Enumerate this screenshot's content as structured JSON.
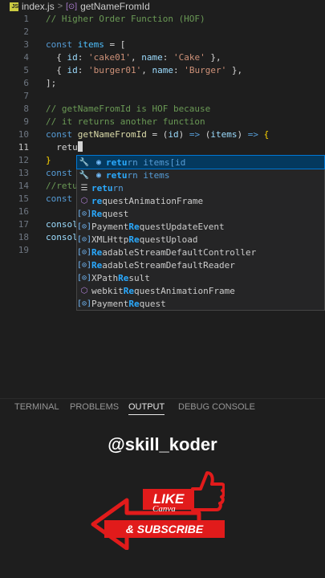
{
  "breadcrumb": {
    "js_badge": "JS",
    "file": "index.js",
    "separator": ">",
    "symbol_icon": "[⊙]",
    "symbol": "getNameFromId"
  },
  "editor": {
    "lines": [
      {
        "n": "1",
        "tokens": [
          [
            "c",
            "// Higher Order Function (HOF)"
          ]
        ]
      },
      {
        "n": "2",
        "tokens": []
      },
      {
        "n": "3",
        "tokens": [
          [
            "k",
            "const "
          ],
          [
            "v",
            "items"
          ],
          [
            "w",
            " = ["
          ]
        ]
      },
      {
        "n": "4",
        "tokens": [
          [
            "w",
            "  { "
          ],
          [
            "p",
            "id"
          ],
          [
            "w",
            ": "
          ],
          [
            "s",
            "'cake01'"
          ],
          [
            "w",
            ", "
          ],
          [
            "p",
            "name"
          ],
          [
            "w",
            ": "
          ],
          [
            "s",
            "'Cake'"
          ],
          [
            "w",
            " },"
          ]
        ]
      },
      {
        "n": "5",
        "tokens": [
          [
            "w",
            "  { "
          ],
          [
            "p",
            "id"
          ],
          [
            "w",
            ": "
          ],
          [
            "s",
            "'burger01'"
          ],
          [
            "w",
            ", "
          ],
          [
            "p",
            "name"
          ],
          [
            "w",
            ": "
          ],
          [
            "s",
            "'Burger'"
          ],
          [
            "w",
            " },"
          ]
        ]
      },
      {
        "n": "6",
        "tokens": [
          [
            "w",
            "];"
          ]
        ]
      },
      {
        "n": "7",
        "tokens": []
      },
      {
        "n": "8",
        "tokens": [
          [
            "c",
            "// getNameFromId is HOF because"
          ]
        ]
      },
      {
        "n": "9",
        "tokens": [
          [
            "c",
            "// it returns another function"
          ]
        ]
      },
      {
        "n": "10",
        "tokens": [
          [
            "k",
            "const "
          ],
          [
            "f",
            "getNameFromId"
          ],
          [
            "w",
            " = ("
          ],
          [
            "p",
            "id"
          ],
          [
            "w",
            ") "
          ],
          [
            "k",
            "=>"
          ],
          [
            "w",
            " ("
          ],
          [
            "p",
            "items"
          ],
          [
            "w",
            ") "
          ],
          [
            "k",
            "=>"
          ],
          [
            "w",
            " "
          ],
          [
            "y",
            "{"
          ]
        ]
      },
      {
        "n": "11",
        "tokens": [
          [
            "w",
            "  retu"
          ]
        ],
        "cursor": true
      },
      {
        "n": "12",
        "tokens": [
          [
            "y",
            "}"
          ]
        ]
      },
      {
        "n": "13",
        "tokens": [
          [
            "k",
            "const "
          ]
        ]
      },
      {
        "n": "14",
        "tokens": [
          [
            "c",
            "//retu"
          ]
        ]
      },
      {
        "n": "15",
        "tokens": [
          [
            "k",
            "const "
          ]
        ]
      },
      {
        "n": "16",
        "tokens": []
      },
      {
        "n": "17",
        "tokens": [
          [
            "p",
            "consol"
          ]
        ]
      },
      {
        "n": "18",
        "tokens": [
          [
            "p",
            "consol"
          ]
        ]
      },
      {
        "n": "19",
        "tokens": []
      }
    ]
  },
  "suggestions": [
    {
      "icon1": "🔧",
      "icon2": "◉",
      "icon2_type": "var",
      "pre": "",
      "match": "retu",
      "post": "rn items[id",
      "selected": true,
      "kw": true
    },
    {
      "icon1": "🔧",
      "icon2": "◉",
      "icon2_type": "var",
      "pre": "",
      "match": "retu",
      "post": "rn items",
      "kw": true
    },
    {
      "icon1": "☰",
      "icon2": "",
      "pre": "",
      "match": "retu",
      "post": "rn",
      "kw": true
    },
    {
      "icon1": "⬡",
      "icon2": "",
      "icon1_type": "box",
      "pre": "",
      "match": "re",
      "post": "questAnimationFrame"
    },
    {
      "icon1": "[⊙]",
      "icon2": "",
      "icon1_type": "var",
      "pre": "",
      "match": "Re",
      "post": "quest"
    },
    {
      "icon1": "[⊙]",
      "icon2": "",
      "icon1_type": "var",
      "pre": "Payment",
      "match": "Re",
      "post": "questUpdateEvent"
    },
    {
      "icon1": "[⊙]",
      "icon2": "",
      "icon1_type": "var",
      "pre": "XMLHttp",
      "match": "Re",
      "post": "questUpload"
    },
    {
      "icon1": "[⊙]",
      "icon2": "",
      "icon1_type": "var",
      "pre": "",
      "match": "Re",
      "post": "adableStreamDefaultController"
    },
    {
      "icon1": "[⊙]",
      "icon2": "",
      "icon1_type": "var",
      "pre": "",
      "match": "Re",
      "post": "adableStreamDefaultReader"
    },
    {
      "icon1": "[⊙]",
      "icon2": "",
      "icon1_type": "var",
      "pre": "XPath",
      "match": "Re",
      "post": "sult"
    },
    {
      "icon1": "⬡",
      "icon2": "",
      "icon1_type": "box",
      "pre": "webkit",
      "match": "Re",
      "post": "questAnimationFrame"
    },
    {
      "icon1": "[⊙]",
      "icon2": "",
      "icon1_type": "var",
      "pre": "Payment",
      "match": "Re",
      "post": "quest"
    }
  ],
  "panel": {
    "tabs": [
      {
        "label": "TERMINAL",
        "active": false
      },
      {
        "label": "PROBLEMS",
        "active": false
      },
      {
        "label": "OUTPUT",
        "active": true
      },
      {
        "label": "DEBUG CONSOLE",
        "active": false
      }
    ]
  },
  "overlay": {
    "handle": "@skill_koder",
    "like": "LIKE",
    "canva": "Canva",
    "subscribe": "& SUBSCRIBE",
    "accent": "#e11b1b"
  }
}
